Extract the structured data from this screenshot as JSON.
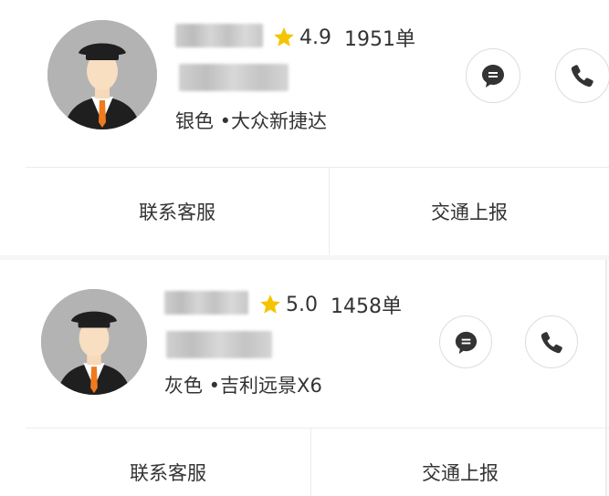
{
  "drivers": [
    {
      "rating": "4.9",
      "orders": "1951单",
      "car": "银色 •大众新捷达",
      "actions": {
        "contact_service": "联系客服",
        "traffic_report": "交通上报"
      }
    },
    {
      "rating": "5.0",
      "orders": "1458单",
      "car": "灰色 •吉利远景X6",
      "actions": {
        "contact_service": "联系客服",
        "traffic_report": "交通上报"
      }
    }
  ],
  "colors": {
    "star": "#F5C400",
    "icon": "#333333",
    "avatar_bg": "#B3B3B3",
    "suit": "#1F1F1F",
    "tie": "#F07A1E"
  },
  "icons": {
    "message": "chat-bubble-icon",
    "call": "phone-icon",
    "rating": "star-icon"
  }
}
